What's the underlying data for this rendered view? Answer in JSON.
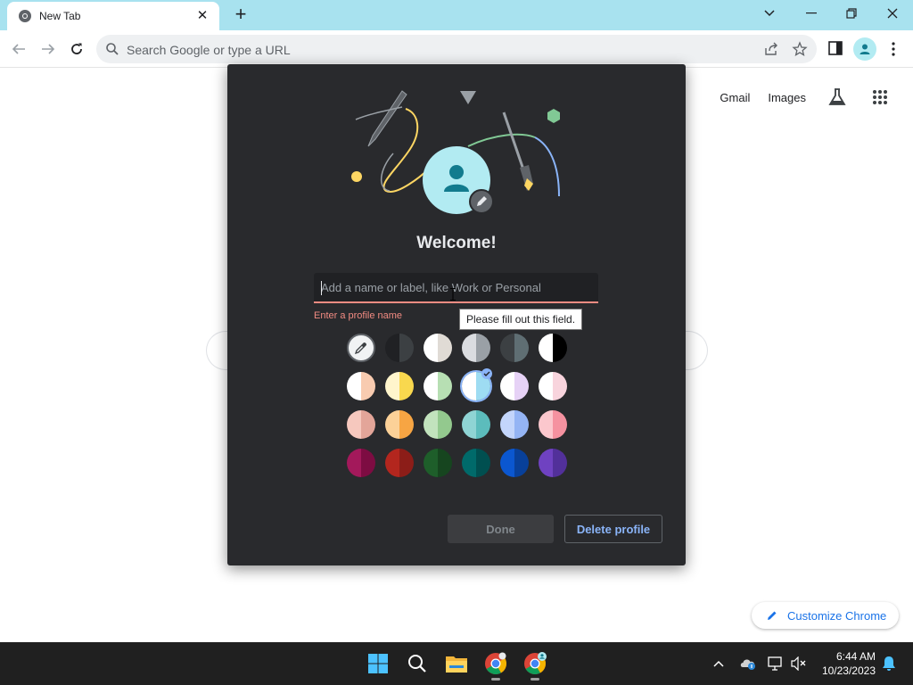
{
  "browser": {
    "tab_title": "New Tab",
    "omnibox_placeholder": "Search Google or type a URL"
  },
  "ntp": {
    "gmail": "Gmail",
    "images": "Images",
    "customize": "Customize Chrome"
  },
  "dialog": {
    "welcome": "Welcome!",
    "name_placeholder": "Add a name or label, like Work or Personal",
    "name_value": "",
    "error": "Enter a profile name",
    "tooltip": "Please fill out this field.",
    "done": "Done",
    "delete": "Delete profile",
    "swatch_rows": [
      [
        [
          "picker",
          "picker"
        ],
        [
          "#202124",
          "#3c4043"
        ],
        [
          "#ffffff",
          "#e0dbd5"
        ],
        [
          "#dadce0",
          "#9aa0a6"
        ],
        [
          "#3c4043",
          "#5f6e73"
        ],
        [
          "#ffffff",
          "#000000"
        ]
      ],
      [
        [
          "#ffffff",
          "#f8cbb0"
        ],
        [
          "#fff5cc",
          "#f9d84e"
        ],
        [
          "#ffffff",
          "#b7dfb3"
        ],
        [
          "#ffffff",
          "#9edcf2"
        ],
        [
          "#ffffff",
          "#e6d2f6"
        ],
        [
          "#ffffff",
          "#f8d4dd"
        ]
      ],
      [
        [
          "#f6c8be",
          "#e3a599"
        ],
        [
          "#fcd198",
          "#f7a543"
        ],
        [
          "#c2e3bd",
          "#93c98e"
        ],
        [
          "#8fd4d4",
          "#5cbcbc"
        ],
        [
          "#c3d5fb",
          "#94b4f4"
        ],
        [
          "#fbc7cd",
          "#f592a0"
        ]
      ],
      [
        [
          "#a3195b",
          "#7d0c42"
        ],
        [
          "#b3261e",
          "#8c1d18"
        ],
        [
          "#1e5e2a",
          "#16451f"
        ],
        [
          "#006a6a",
          "#004f50"
        ],
        [
          "#0b57d0",
          "#08409a"
        ],
        [
          "#6f42c1",
          "#52309a"
        ]
      ]
    ],
    "selected_swatch": "1-3"
  },
  "taskbar": {
    "time": "6:44 AM",
    "date": "10/23/2023"
  },
  "colors": {
    "tabstrip": "#a8e2ef",
    "dialog_bg": "#292a2d",
    "error": "#f28b82",
    "accent": "#8ab4f8"
  }
}
